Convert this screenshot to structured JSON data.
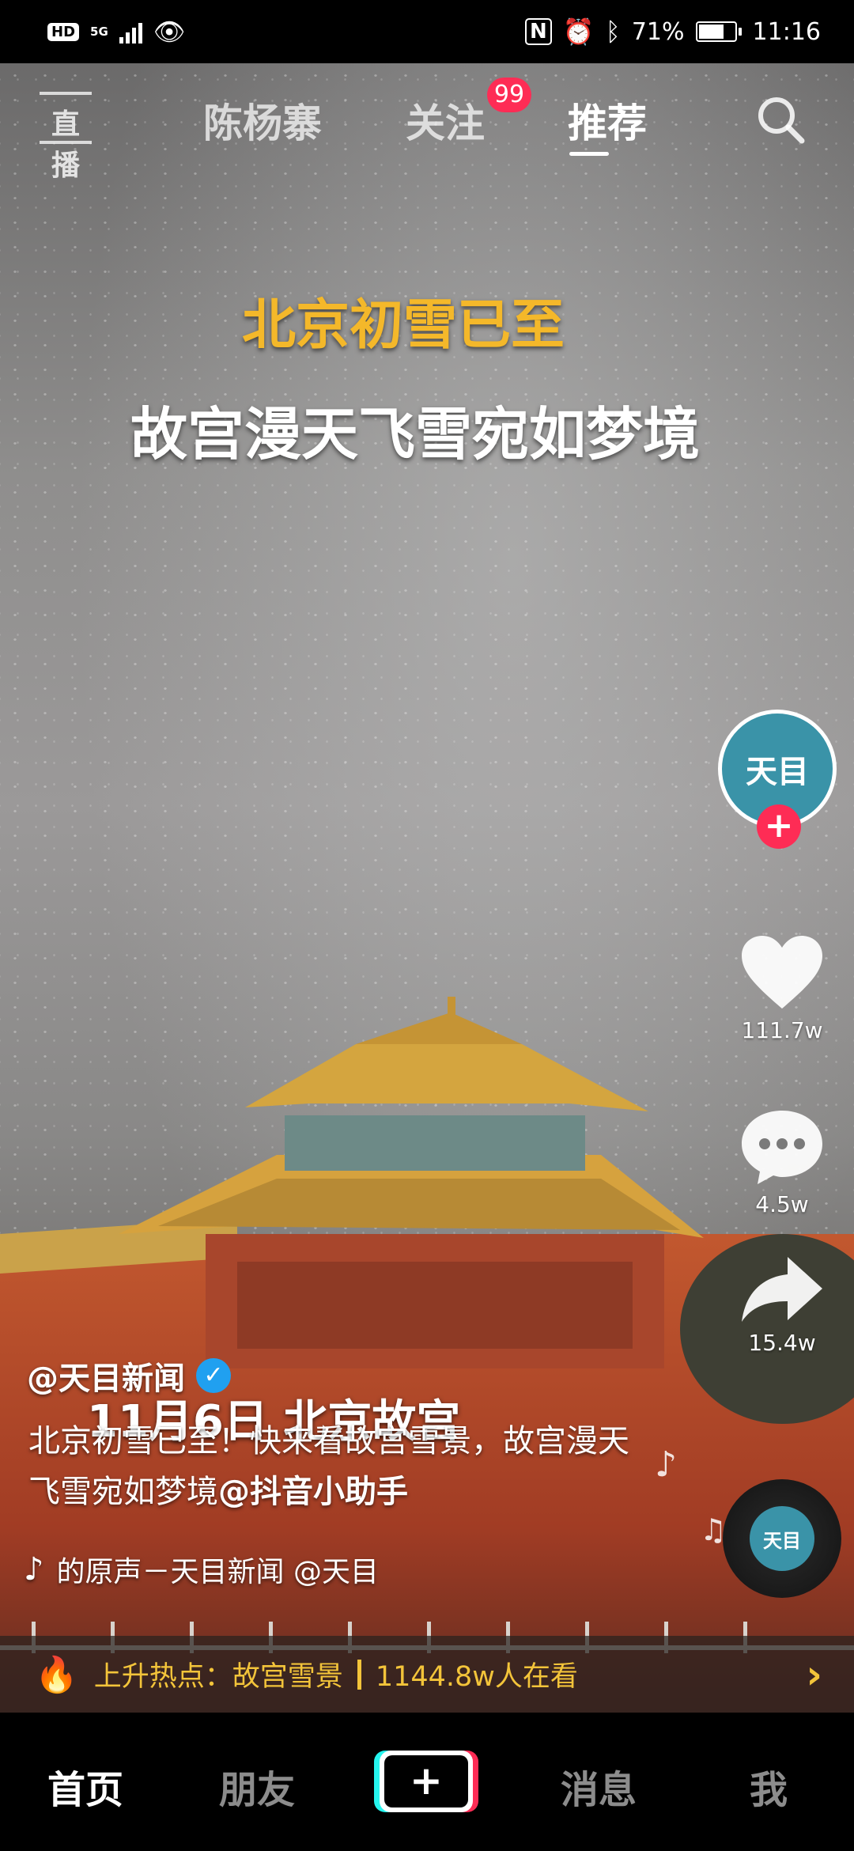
{
  "status_bar": {
    "hd": "HD",
    "network": "5G",
    "battery": "71%",
    "battery_level": 0.71,
    "time": "11:16"
  },
  "top_nav": {
    "live_label": "直播",
    "tabs": [
      "陈杨寨",
      "关注",
      "推荐"
    ],
    "active_tab": "推荐",
    "follow_badge": "99"
  },
  "video": {
    "headline_1": "北京初雪已至",
    "headline_2": "故宫漫天飞雪宛如梦境",
    "date_overlay": "11月6日 北京故宫"
  },
  "author": {
    "avatar_text": "天目",
    "name": "@天目新闻"
  },
  "description": {
    "text": "北京初雪已至！快来看故宫雪景，故宫漫天飞雪宛如梦境",
    "mention": "@抖音小助手"
  },
  "sound": {
    "text": "的原声－天目新闻    @天目"
  },
  "actions": {
    "likes": "111.7w",
    "comments": "4.5w",
    "shares": "15.4w"
  },
  "hot_topic": {
    "label": "上升热点：故宫雪景",
    "viewers": "1144.8w人在看"
  },
  "bottom_nav": {
    "home": "首页",
    "friends": "朋友",
    "create": "+",
    "messages": "消息",
    "me": "我"
  },
  "colors": {
    "accent_red": "#fe2c55",
    "accent_cyan": "#25f4ee",
    "headline_gold": "#f4b82a",
    "hot_gold": "#f3c43a",
    "avatar_teal": "#3a93a8"
  },
  "icons": [
    "signal-icon",
    "eye-icon",
    "nfc-icon",
    "alarm-icon",
    "bluetooth-icon",
    "battery-icon",
    "search-icon",
    "heart-icon",
    "comment-icon",
    "share-icon",
    "music-note-icon",
    "flame-icon",
    "chevron-right-icon",
    "verified-icon",
    "tiktok-logo-icon"
  ]
}
